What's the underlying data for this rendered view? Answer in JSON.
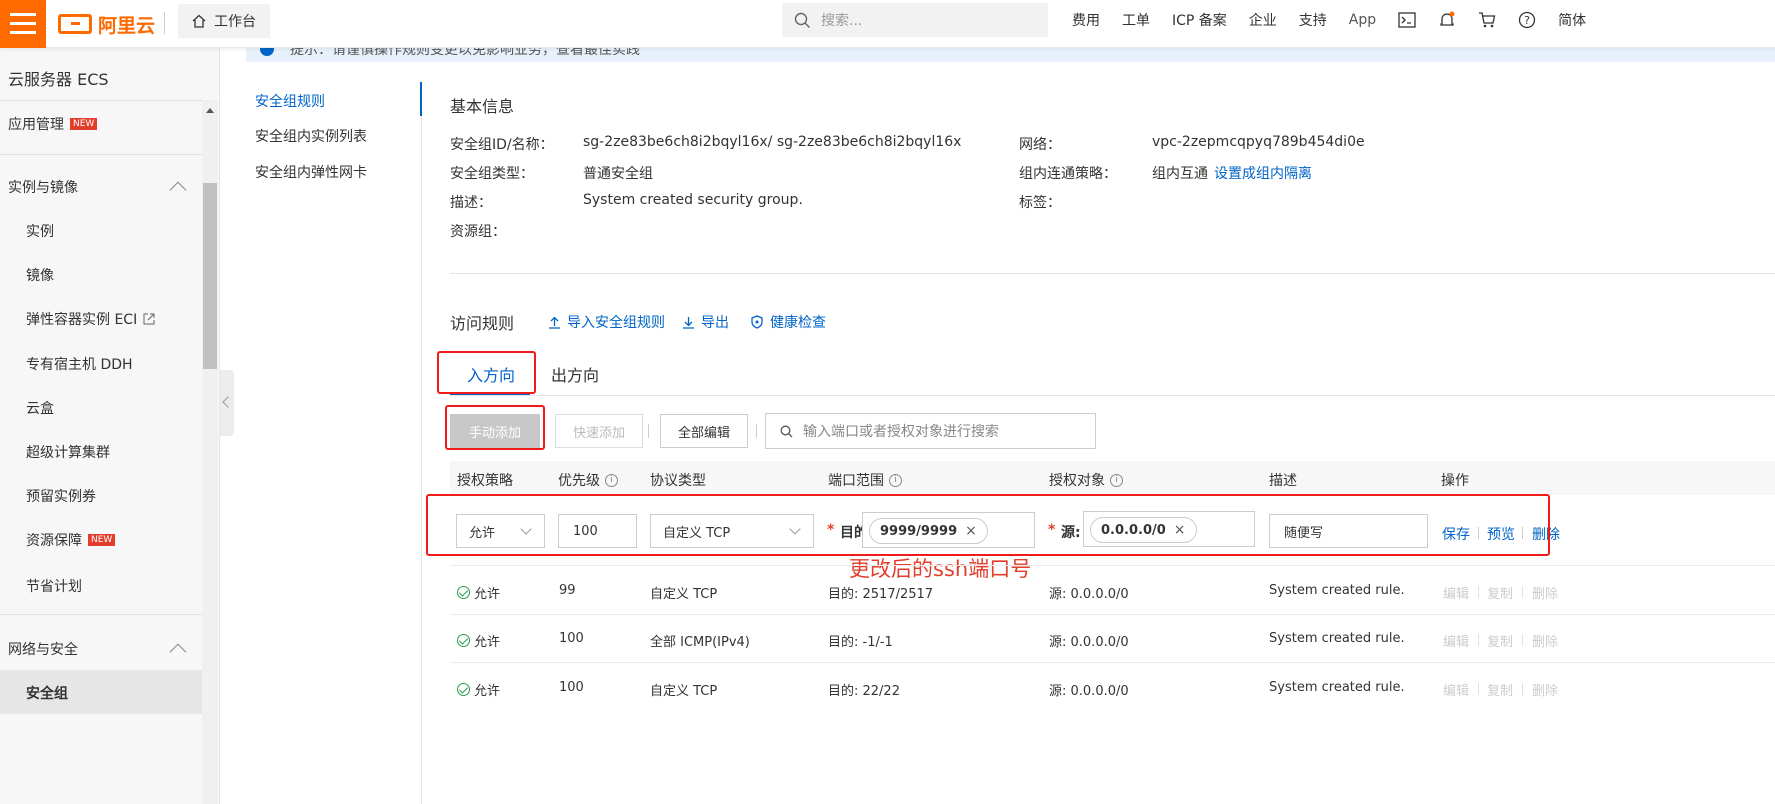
{
  "topbar": {
    "logo": "阿里云",
    "workbench": "工作台",
    "search_placeholder": "搜索...",
    "nav": [
      "费用",
      "工单",
      "ICP 备案",
      "企业",
      "支持",
      "App"
    ],
    "lang": "简体"
  },
  "sidebar": {
    "title": "云服务器 ECS",
    "app_mgmt": "应用管理",
    "new_badge": "NEW",
    "group_instances": "实例与镜像",
    "items": [
      "实例",
      "镜像",
      "弹性容器实例 ECI",
      "专有宿主机 DDH",
      "云盒",
      "超级计算集群",
      "预留实例券",
      "资源保障",
      "节省计划"
    ],
    "group_network": "网络与安全",
    "active_item": "安全组"
  },
  "notice": {
    "text": "提示：请谨慎操作规则变更以免影响业务，查看最佳实践"
  },
  "subnav": [
    "安全组规则",
    "安全组内实例列表",
    "安全组内弹性网卡"
  ],
  "basic": {
    "title": "基本信息",
    "id_label": "安全组ID/名称：",
    "id_value": "sg-2ze83be6ch8i2bqyl16x/ sg-2ze83be6ch8i2bqyl16x",
    "type_label": "安全组类型：",
    "type_value": "普通安全组",
    "desc_label": "描述：",
    "desc_value": "System created security group.",
    "rg_label": "资源组：",
    "net_label": "网络：",
    "net_value": "vpc-2zepmcqpyq789b454di0e",
    "policy_label": "组内连通策略：",
    "policy_value": "组内互通",
    "policy_link": "设置成组内隔离",
    "tag_label": "标签："
  },
  "rules": {
    "title": "访问规则",
    "import": "导入安全组规则",
    "export": "导出",
    "health": "健康检查",
    "tab_in": "入方向",
    "tab_out": "出方向",
    "btn_manual": "手动添加",
    "btn_quick": "快速添加",
    "btn_edit_all": "全部编辑",
    "search_placeholder": "输入端口或者授权对象进行搜索"
  },
  "table": {
    "headers": [
      "授权策略",
      "优先级",
      "协议类型",
      "端口范围",
      "授权对象",
      "描述",
      "操作"
    ],
    "edit_row": {
      "policy": "允许",
      "priority": "100",
      "protocol": "自定义 TCP",
      "dest_label": "目的:",
      "dest_value": "9999/9999",
      "src_label": "源:",
      "src_value": "0.0.0.0/0",
      "desc": "随便写",
      "save": "保存",
      "preview": "预览",
      "delete": "删除"
    },
    "rows": [
      {
        "policy": "允许",
        "priority": "99",
        "protocol": "自定义 TCP",
        "port": "目的: 2517/2517",
        "src": "源: 0.0.0.0/0",
        "desc": "System created rule."
      },
      {
        "policy": "允许",
        "priority": "100",
        "protocol": "全部 ICMP(IPv4)",
        "port": "目的: -1/-1",
        "src": "源: 0.0.0.0/0",
        "desc": "System created rule."
      },
      {
        "policy": "允许",
        "priority": "100",
        "protocol": "自定义 TCP",
        "port": "目的: 22/22",
        "src": "源: 0.0.0.0/0",
        "desc": "System created rule."
      }
    ],
    "ops": [
      "编辑",
      "复制",
      "删除"
    ]
  },
  "annotation": "更改后的ssh端口号",
  "colors": {
    "brand": "#ff6a00",
    "link": "#0064c8",
    "annotation": "#f21b1b"
  }
}
